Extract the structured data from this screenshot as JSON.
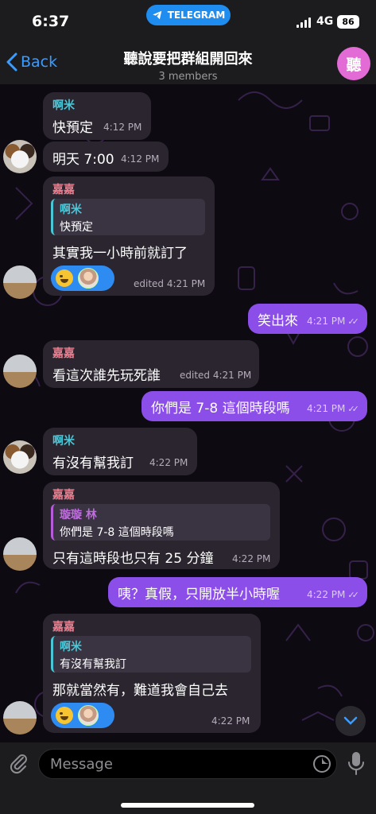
{
  "status_bar": {
    "time": "6:37",
    "app_pill": "TELEGRAM",
    "network": "4G",
    "battery": "86"
  },
  "header": {
    "back_label": "Back",
    "title": "聽說要把群組開回來",
    "subtitle": "3 members",
    "avatar_letter": "聽"
  },
  "messages": [
    {
      "sender": "啊米",
      "text": "快預定",
      "time": "4:12 PM"
    },
    {
      "text": "明天 7:00",
      "time": "4:12 PM"
    },
    {
      "sender": "嘉嘉",
      "reply_name": "啊米",
      "reply_text": "快預定",
      "text": "其實我一小時前就訂了",
      "time": "edited 4:21 PM"
    },
    {
      "text": "笑出來",
      "time": "4:21 PM"
    },
    {
      "sender": "嘉嘉",
      "text": "看這次誰先玩死誰",
      "time": "edited 4:21 PM"
    },
    {
      "text": "你們是 7-8 這個時段嗎",
      "time": "4:21 PM"
    },
    {
      "sender": "啊米",
      "text": "有沒有幫我訂",
      "time": "4:22 PM"
    },
    {
      "sender": "嘉嘉",
      "reply_name": "璇璇 林",
      "reply_text": "你們是 7-8 這個時段嗎",
      "text": "只有這時段也只有 25 分鐘",
      "time": "4:22 PM"
    },
    {
      "text": "咦？真假，只開放半小時喔",
      "time": "4:22 PM"
    },
    {
      "sender": "嘉嘉",
      "reply_name": "啊米",
      "reply_text": "有沒有幫我訂",
      "text": "那就當然有，難道我會自己去",
      "time": "4:22 PM"
    }
  ],
  "input": {
    "placeholder": "Message"
  },
  "colors": {
    "outgoing_bubble": "#8b4ee8",
    "incoming_bubble": "#2b2530",
    "accent_blue": "#3b9cff",
    "sender_pink": "#f47a8c",
    "sender_teal": "#4bc6d6",
    "group_avatar": "#e36bd6"
  },
  "icons": [
    "telegram-icon",
    "back-chevron-icon",
    "paperclip-icon",
    "sticker-icon",
    "microphone-icon",
    "chevron-down-icon",
    "laughing-emoji-icon",
    "double-check-icon"
  ]
}
